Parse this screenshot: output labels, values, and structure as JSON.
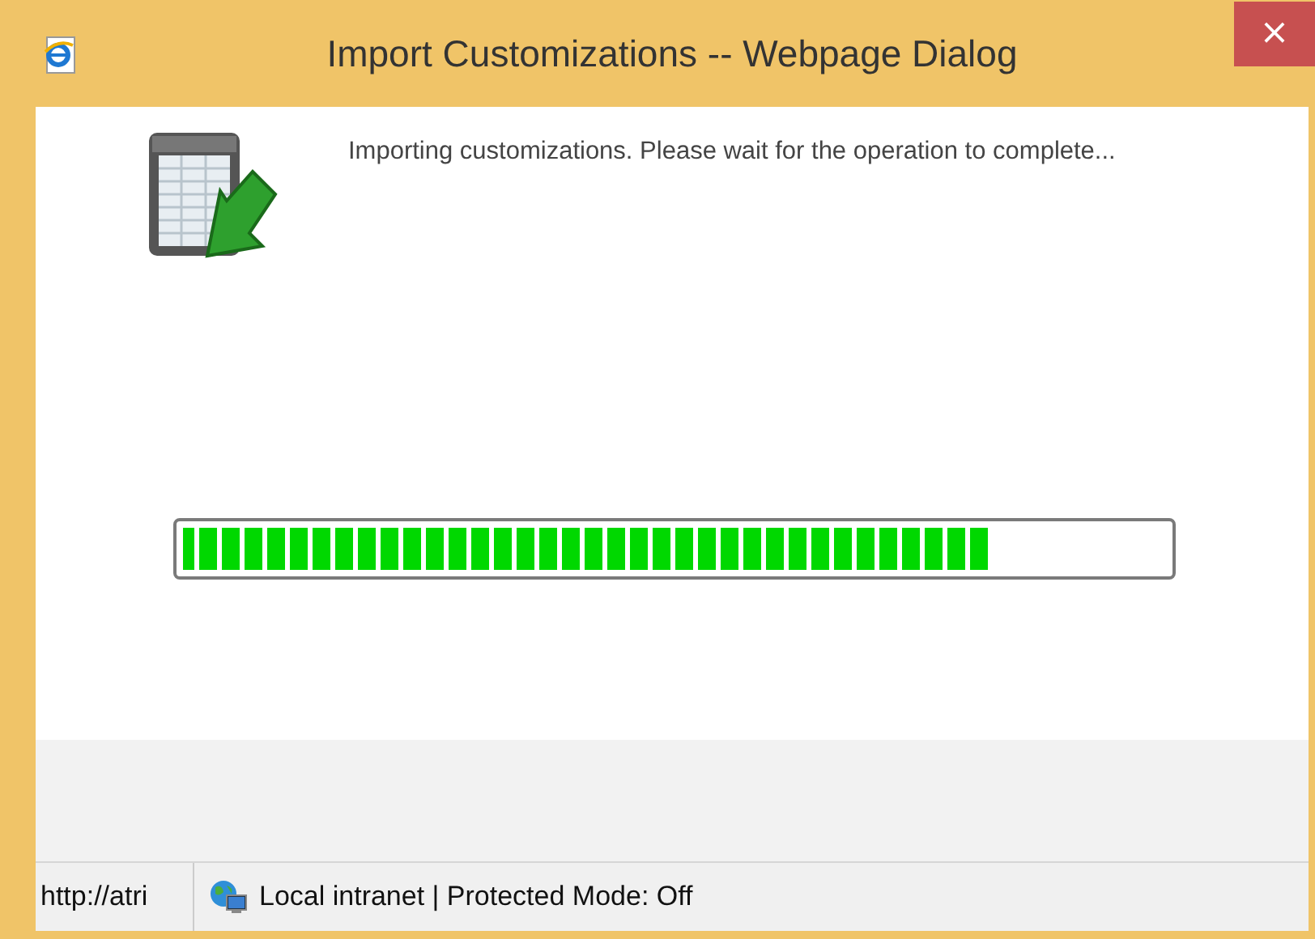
{
  "window": {
    "title": "Import Customizations -- Webpage Dialog",
    "close": "×"
  },
  "message": "Importing customizations. Please wait for the operation to complete...",
  "progress": {
    "level": 0.82
  },
  "status_bar": {
    "url": "http://atri",
    "zone": "Local intranet | Protected Mode: Off"
  }
}
